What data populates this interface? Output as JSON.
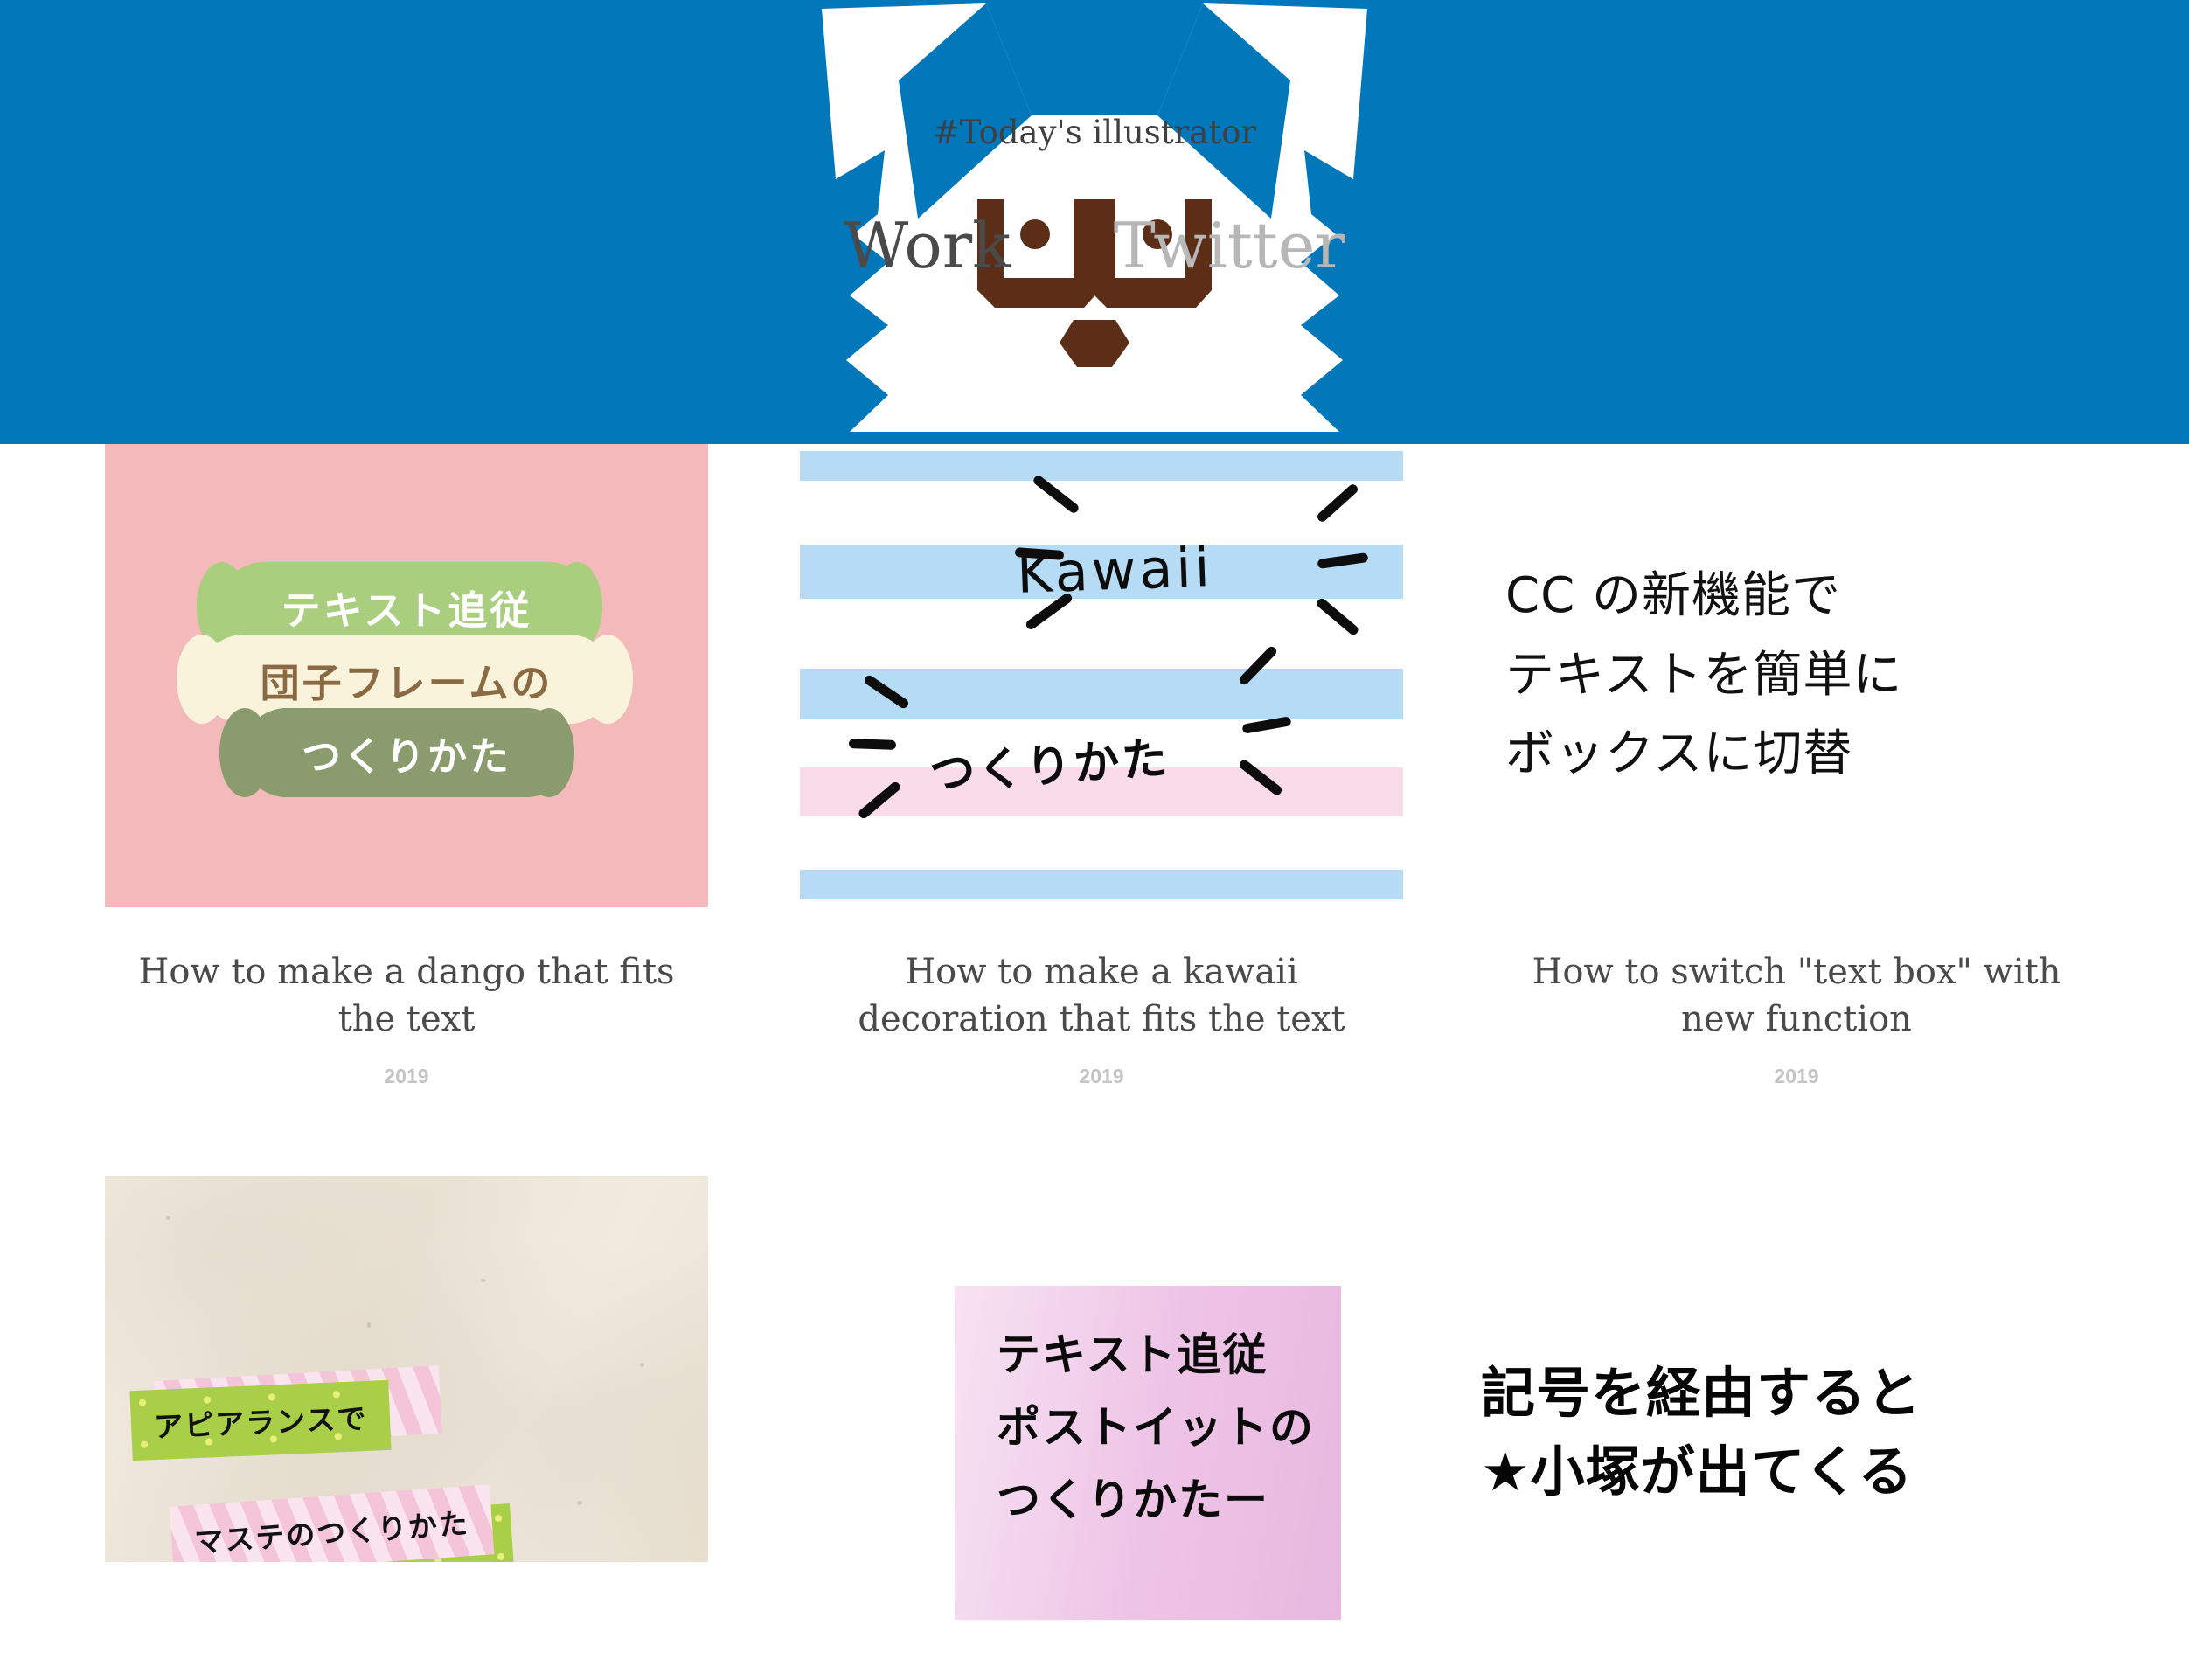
{
  "header": {
    "background_color": "#0277ba",
    "logo_name": "cat-head-logo",
    "hash_title": "#Today's illustrator",
    "nav": [
      {
        "label": "Work",
        "state": "active",
        "color": "#4a4a4a"
      },
      {
        "label": "Twitter",
        "state": "inactive",
        "color": "#b7b7b7"
      }
    ]
  },
  "gallery": {
    "rows": [
      {
        "items": [
          {
            "thumb_name": "dango-frame-thumbnail",
            "background_color": "#f4b9ba",
            "bubbles": [
              {
                "text": "テキスト追従",
                "fill": "#a9ce7d",
                "text_color": "#ffffff"
              },
              {
                "text": "団子フレームの",
                "fill": "#faf3dc",
                "text_color": "#8a6a42"
              },
              {
                "text": "つくりかた",
                "fill": "#8a9b6d",
                "text_color": "#ffffff"
              }
            ],
            "stick_color": "#a89080",
            "caption": "How to make a dango that fits the text",
            "year": "2019"
          },
          {
            "thumb_name": "kawaii-decoration-thumbnail",
            "background_color": "#ffffff",
            "stripe_colors": {
              "blue": "#b6dcf5",
              "pink": "#fadce8"
            },
            "handwritten": [
              {
                "text": "Kawaii"
              },
              {
                "text": "つくりかた"
              }
            ],
            "caption": "How to make a kawaii decoration that fits the text",
            "year": "2019"
          },
          {
            "thumb_name": "text-box-switch-thumbnail",
            "background_color": "#ffffff",
            "lines": [
              "CC の新機能で",
              "テキストを簡単に",
              "ボックスに切替"
            ],
            "caption": "How to switch \"text box\" with new function",
            "year": "2019"
          }
        ]
      },
      {
        "items": [
          {
            "thumb_name": "masking-tape-thumbnail",
            "background_color": "#ece4d6",
            "tapes": [
              {
                "text": "アピアランスで",
                "fill": "#a8cf47",
                "style": "dotted-green"
              },
              {
                "text": "マステのつくりかた",
                "fill": "#f4c4d8",
                "style": "striped-pink"
              }
            ]
          },
          {
            "thumb_name": "postit-thumbnail",
            "background_gradient": "#eec4e6",
            "lines": [
              "テキスト追従",
              "ポストイットの",
              "つくりかたー"
            ]
          },
          {
            "thumb_name": "kigou-kozuka-thumbnail",
            "background_color": "#ffffff",
            "lines": [
              "記号を経由すると",
              "★小塚が出てくる"
            ]
          }
        ]
      }
    ]
  }
}
